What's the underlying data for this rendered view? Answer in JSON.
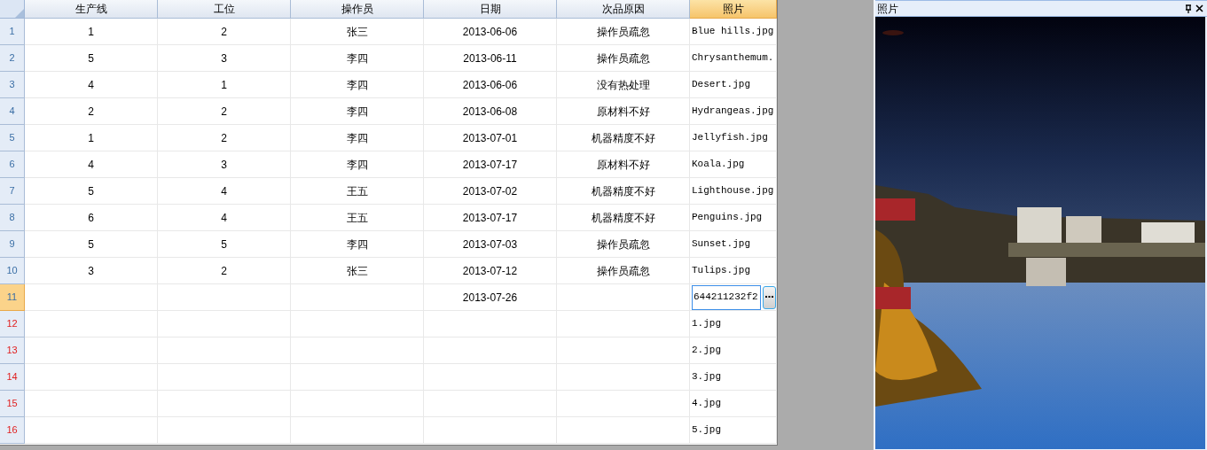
{
  "grid": {
    "columns": [
      {
        "label": "生产线",
        "selected": false
      },
      {
        "label": "工位",
        "selected": false
      },
      {
        "label": "操作员",
        "selected": false
      },
      {
        "label": "日期",
        "selected": false
      },
      {
        "label": "次品原因",
        "selected": false
      },
      {
        "label": "照片",
        "selected": true
      }
    ],
    "rows": [
      {
        "number": "1",
        "selected": false,
        "new": false,
        "cells": [
          "1",
          "2",
          "张三",
          "2013-06-06",
          "操作员疏忽",
          "Blue hills.jpg"
        ]
      },
      {
        "number": "2",
        "selected": false,
        "new": false,
        "cells": [
          "5",
          "3",
          "李四",
          "2013-06-11",
          "操作员疏忽",
          "Chrysanthemum."
        ]
      },
      {
        "number": "3",
        "selected": false,
        "new": false,
        "cells": [
          "4",
          "1",
          "李四",
          "2013-06-06",
          "没有热处理",
          "Desert.jpg"
        ]
      },
      {
        "number": "4",
        "selected": false,
        "new": false,
        "cells": [
          "2",
          "2",
          "李四",
          "2013-06-08",
          "原材料不好",
          "Hydrangeas.jpg"
        ]
      },
      {
        "number": "5",
        "selected": false,
        "new": false,
        "cells": [
          "1",
          "2",
          "李四",
          "2013-07-01",
          "机器精度不好",
          "Jellyfish.jpg"
        ]
      },
      {
        "number": "6",
        "selected": false,
        "new": false,
        "cells": [
          "4",
          "3",
          "李四",
          "2013-07-17",
          "原材料不好",
          "Koala.jpg"
        ]
      },
      {
        "number": "7",
        "selected": false,
        "new": false,
        "cells": [
          "5",
          "4",
          "王五",
          "2013-07-02",
          "机器精度不好",
          "Lighthouse.jpg"
        ]
      },
      {
        "number": "8",
        "selected": false,
        "new": false,
        "cells": [
          "6",
          "4",
          "王五",
          "2013-07-17",
          "机器精度不好",
          "Penguins.jpg"
        ]
      },
      {
        "number": "9",
        "selected": false,
        "new": false,
        "cells": [
          "5",
          "5",
          "李四",
          "2013-07-03",
          "操作员疏忽",
          "Sunset.jpg"
        ]
      },
      {
        "number": "10",
        "selected": false,
        "new": false,
        "cells": [
          "3",
          "2",
          "张三",
          "2013-07-12",
          "操作员疏忽",
          "Tulips.jpg"
        ]
      },
      {
        "number": "11",
        "selected": true,
        "new": false,
        "editing": true,
        "cells": [
          "",
          "",
          "",
          "2013-07-26",
          "",
          "644211232f2"
        ]
      },
      {
        "number": "12",
        "selected": false,
        "new": true,
        "cells": [
          "",
          "",
          "",
          "",
          "",
          "1.jpg"
        ]
      },
      {
        "number": "13",
        "selected": false,
        "new": true,
        "cells": [
          "",
          "",
          "",
          "",
          "",
          "2.jpg"
        ]
      },
      {
        "number": "14",
        "selected": false,
        "new": true,
        "cells": [
          "",
          "",
          "",
          "",
          "",
          "3.jpg"
        ]
      },
      {
        "number": "15",
        "selected": false,
        "new": true,
        "cells": [
          "",
          "",
          "",
          "",
          "",
          "4.jpg"
        ]
      },
      {
        "number": "16",
        "selected": false,
        "new": true,
        "cells": [
          "",
          "",
          "",
          "",
          "",
          "5.jpg"
        ]
      }
    ]
  },
  "panel": {
    "title": "照片",
    "pinned": true
  }
}
